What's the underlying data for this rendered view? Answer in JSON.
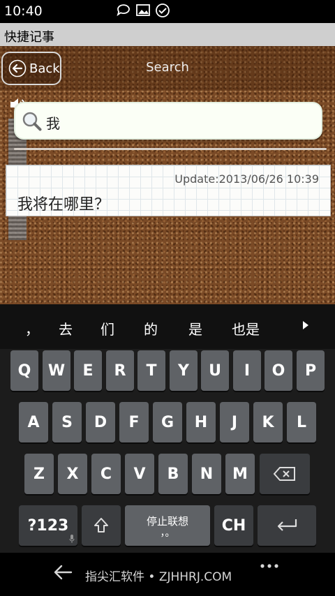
{
  "status_bar": {
    "time": "10:40",
    "icons": [
      "chat-bubble-icon",
      "image-icon",
      "check-circle-icon"
    ]
  },
  "app": {
    "title": "快捷记事"
  },
  "header": {
    "back_label": "Back",
    "title": "Search"
  },
  "search": {
    "value": "我"
  },
  "note": {
    "update": "Update:2013/06/26 10:39",
    "text": "我将在哪里？"
  },
  "keyboard": {
    "candidates": [
      "，",
      "去",
      "们",
      "的",
      "是",
      "也是"
    ],
    "row1": [
      "Q",
      "W",
      "E",
      "R",
      "T",
      "Y",
      "U",
      "I",
      "O",
      "P"
    ],
    "row2": [
      "A",
      "S",
      "D",
      "F",
      "G",
      "H",
      "J",
      "K",
      "L"
    ],
    "row3": [
      "Z",
      "X",
      "C",
      "V",
      "B",
      "N",
      "M"
    ],
    "symbols_label": "?123",
    "space_label": "停止联想",
    "space_sub": "，。",
    "lang_label": "CH"
  },
  "watermark": "指尖汇软件 • ZJHHRJ.COM"
}
